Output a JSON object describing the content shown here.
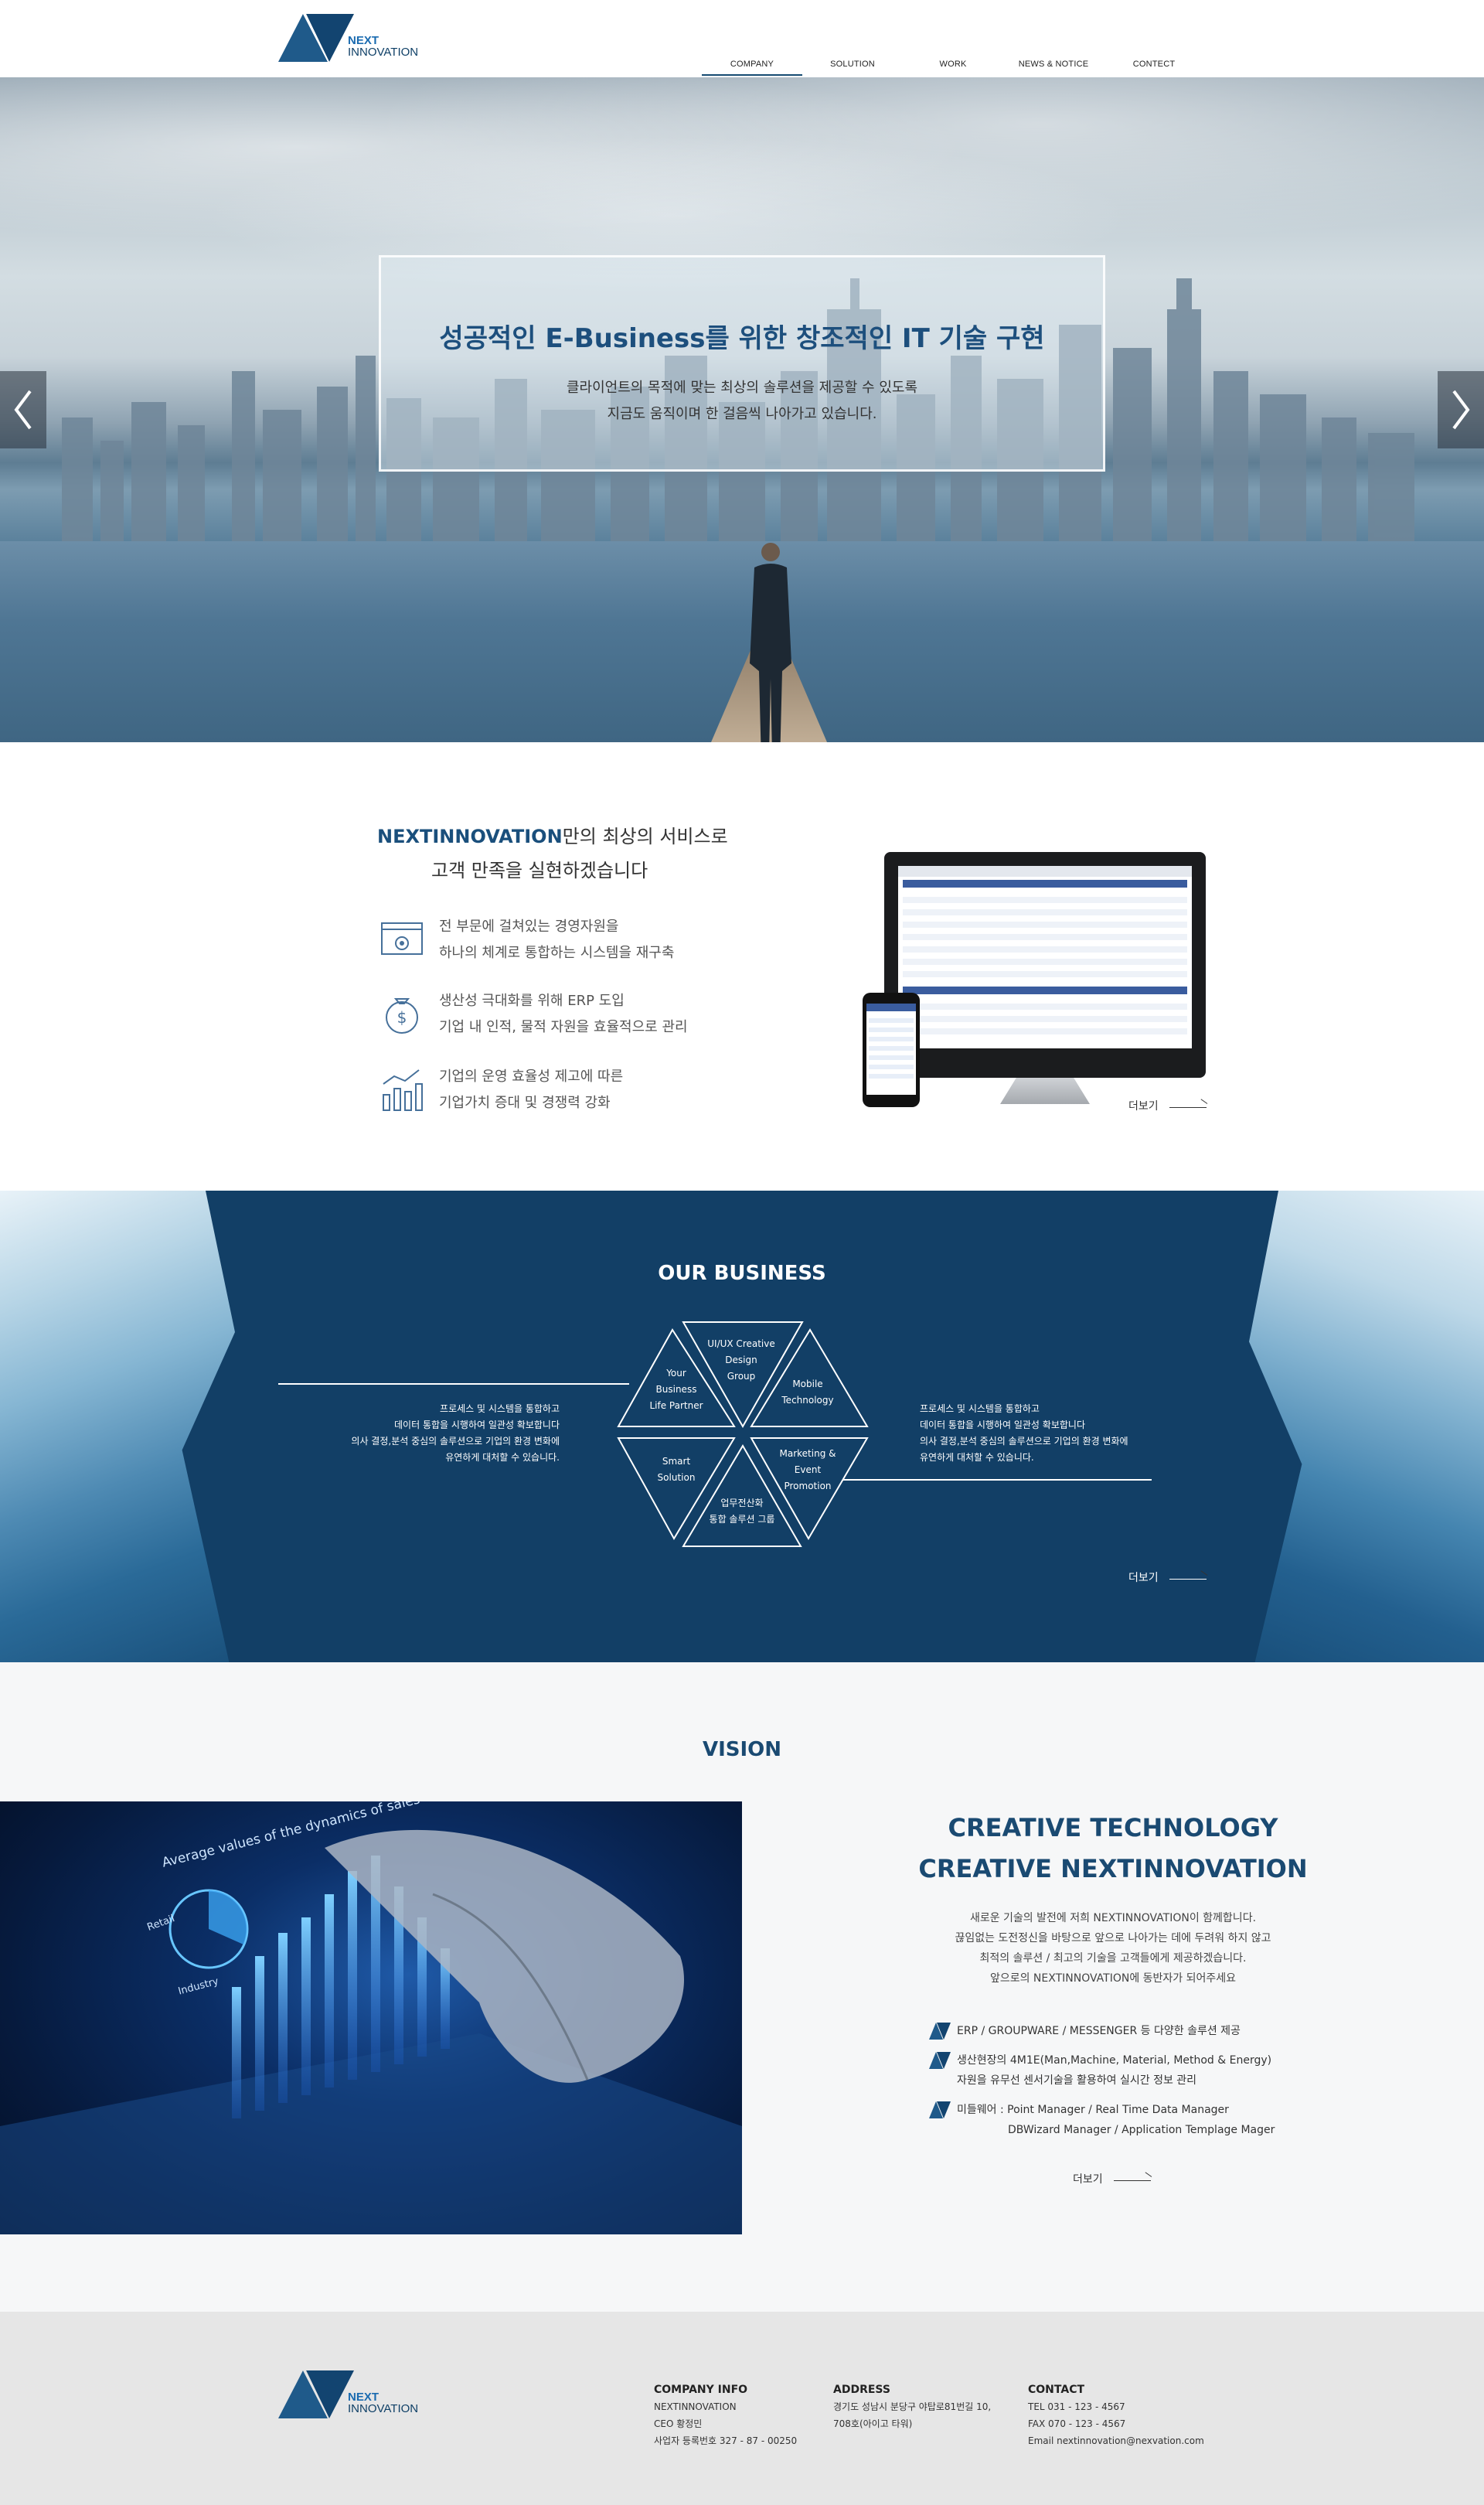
{
  "header": {
    "logo_line1": "NEXT",
    "logo_line2": "INNOVATION",
    "nav": [
      {
        "label": "COMPANY",
        "active": true
      },
      {
        "label": "SOLUTION"
      },
      {
        "label": "WORK"
      },
      {
        "label": "NEWS & NOTICE"
      },
      {
        "label": "CONTECT"
      }
    ]
  },
  "hero": {
    "title": "성공적인 E-Business를 위한 창조적인 IT 기술 구현",
    "sub1": "클라이언트의 목적에 맞는 최상의 솔루션을 제공할 수 있도록",
    "sub2": "지금도 움직이며 한 걸음씩 나아가고 있습니다.",
    "prev_icon": "chevron-left-icon",
    "next_icon": "chevron-right-icon"
  },
  "services": {
    "title_brand": "NEXTINNOVATION",
    "title_rest": "만의 최상의 서비스로",
    "title_line2": "고객 만족을 실현하겠습니다",
    "items": [
      {
        "icon": "settings-monitor-icon",
        "line1": "전 부문에 걸쳐있는 경영자원을",
        "line2": "하나의 체계로 통합하는 시스템을 재구축"
      },
      {
        "icon": "money-bag-icon",
        "line1": "생산성 극대화를 위해 ERP 도입",
        "line2": "기업 내 인적, 물적 자원을 효율적으로 관리"
      },
      {
        "icon": "bar-chart-people-icon",
        "line1": "기업의 운영 효율성 제고에 따른",
        "line2": "기업가치 증대 및 경쟁력 강화"
      }
    ],
    "more": "더보기"
  },
  "business": {
    "title": "OUR BUSINESS",
    "desc_left": [
      "프로세스 및 시스템을 통합하고",
      "데이터 통합을 시행하여 일관성 확보합니다",
      "의사 결정,분석 중심의 솔루션으로 기업의 환경 변화에",
      "유연하게 대처할 수 있습니다."
    ],
    "desc_right": [
      "프로세스 및 시스템을 통합하고",
      "데이터 통합을 시행하여 일관성 확보합니다",
      "의사 결정,분석 중심의 솔루션으로 기업의 환경 변화에",
      "유연하게 대처할 수 있습니다."
    ],
    "triangles": [
      [
        "UI/UX  Creative",
        "Design",
        "Group"
      ],
      [
        "Your",
        "Business",
        "Life Partner"
      ],
      [
        "Mobile",
        "Technology"
      ],
      [
        "Smart",
        "Solution"
      ],
      [
        "Marketing &",
        "Event",
        "Promotion"
      ],
      [
        "업무전산화",
        "통합 솔루션 그룹"
      ]
    ],
    "more": "더보기"
  },
  "vision": {
    "title": "VISION",
    "h1": "CREATIVE TECHNOLOGY",
    "h2": "CREATIVE NEXTINNOVATION",
    "paragraph": [
      "새로운 기술의 발전에 저희 NEXTINNOVATION이 함께합니다.",
      "끊임없는 도전정신을 바탕으로 앞으로 나아가는 데에 두려워 하지 않고",
      "최적의 솔루션 / 최고의 기술을 고객들에게 제공하겠습니다.",
      "앞으로의 NEXTINNOVATION에 동반자가 되어주세요"
    ],
    "list": [
      [
        "ERP / GROUPWARE / MESSENGER 등 다양한 솔루션 제공"
      ],
      [
        "생산현장의 4M1E(Man,Machine, Material, Method & Energy)",
        "자원을 유무선 센서기술을 활용하여 실시간 정보 관리"
      ],
      [
        "미들웨어 : Point Manager / Real Time Data Manager",
        "DBWizard Manager / Application Templage Mager"
      ]
    ],
    "image_labels": {
      "chart_title": "Average values of the dynamics of sales",
      "retail": "Retail",
      "industry": "Industry"
    },
    "more": "더보기"
  },
  "footer": {
    "company_info": {
      "heading": "COMPANY INFO",
      "lines": [
        "NEXTINNOVATION",
        "CEO 황정민",
        "사업자 등록번호 327 - 87 - 00250"
      ]
    },
    "address": {
      "heading": "ADDRESS",
      "lines": [
        "경기도 성남시 분당구 야탑로81번길 10,",
        "708호(아이고 타워)"
      ]
    },
    "contact": {
      "heading": "CONTACT",
      "lines": [
        "TEL 031 - 123 - 4567",
        "FAX 070 - 123 - 4567",
        "Email nextinnovation@nexvation.com"
      ]
    }
  },
  "colors": {
    "brand": "#164b72",
    "accent": "#1a6bb0",
    "business_bg": "#123f66"
  }
}
